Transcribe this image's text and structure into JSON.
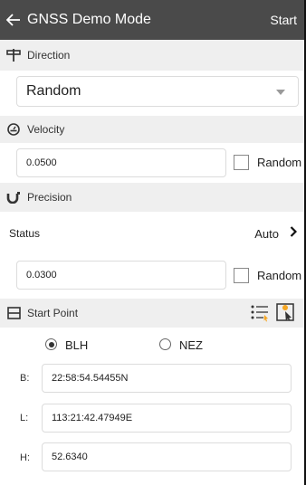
{
  "header": {
    "title": "GNSS Demo Mode",
    "start_label": "Start"
  },
  "direction": {
    "section_label": "Direction",
    "selected": "Random"
  },
  "velocity": {
    "section_label": "Velocity",
    "value": "0.0500",
    "random_label": "Random",
    "random_checked": false
  },
  "precision": {
    "section_label": "Precision",
    "status_label": "Status",
    "status_value": "Auto",
    "value": "0.0300",
    "random_label": "Random",
    "random_checked": false
  },
  "start_point": {
    "section_label": "Start Point",
    "coord_options": [
      "BLH",
      "NEZ"
    ],
    "selected_option": "BLH",
    "fields": [
      {
        "label": "B:",
        "value": "22:58:54.54455N"
      },
      {
        "label": "L:",
        "value": "113:21:42.47949E"
      },
      {
        "label": "H:",
        "value": "52.6340"
      }
    ]
  },
  "colors": {
    "header_bg": "#4a4a4a",
    "section_bg": "#efefef",
    "accent_orange": "#f5a623"
  }
}
